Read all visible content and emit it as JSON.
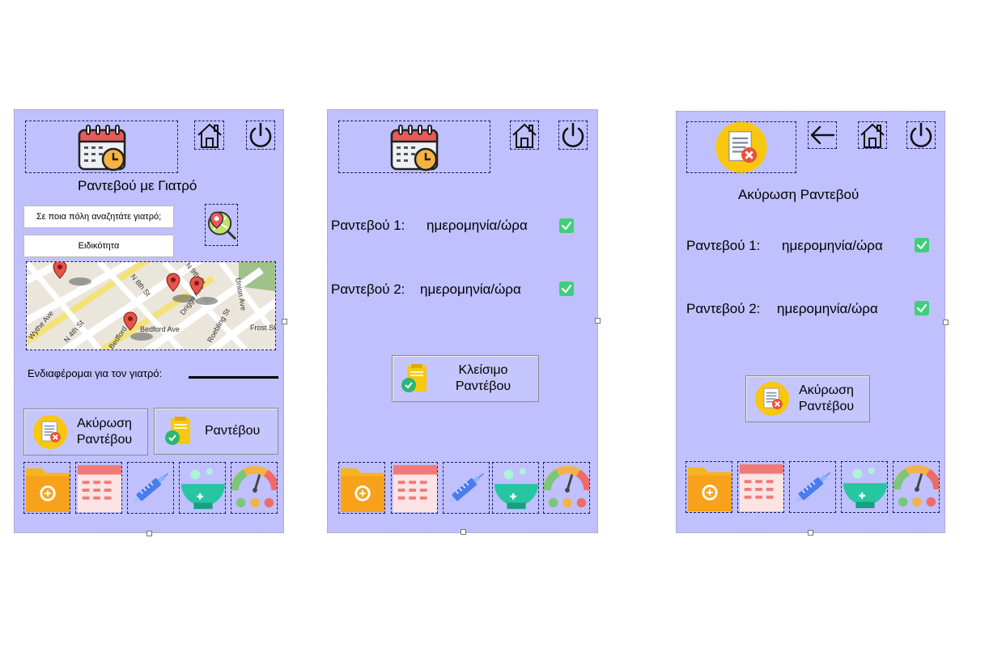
{
  "panel1": {
    "title": "Ραντεβού με Γιατρό",
    "city_placeholder": "Σε ποια πόλη αναζητάτε γιατρό;",
    "specialty_placeholder": "Ειδικότητα",
    "interest_label": "Ενδιαφέρομαι για τον γιατρό:",
    "map_labels": [
      "Wythe Ave",
      "N 4th St",
      "N 8th St",
      "N 9th St",
      "Driggs Ave",
      "Bedford Ave",
      "Union Ave",
      "Roebling St",
      "Frost St",
      "Bedford Ave"
    ],
    "cancel_button_label": "Ακύρωση Ραντέβου",
    "appointment_button_label": "Ραντέβου",
    "icons": [
      "calendar-icon",
      "home-icon",
      "power-icon",
      "map-search-icon"
    ]
  },
  "panel2": {
    "row1_label": "Ραντεβού 1:",
    "row1_value": "ημερομηνία/ώρα",
    "row2_label": "Ραντεβού 2:",
    "row2_value": "ημερομηνία/ώρα",
    "book_button_label": "Κλείσιμο Ραντέβου",
    "icons": [
      "calendar-icon",
      "home-icon",
      "power-icon"
    ]
  },
  "panel3": {
    "title": "Ακύρωση Ραντεβού",
    "row1_label": "Ραντεβού 1:",
    "row1_value": "ημερομηνία/ώρα",
    "row2_label": "Ραντεβού 2:",
    "row2_value": "ημερομηνία/ώρα",
    "cancel_button_label": "Ακύρωση Ραντέβου",
    "icons": [
      "cancel-document-icon",
      "back-arrow-icon",
      "home-icon",
      "power-icon"
    ]
  },
  "bottom_nav": [
    "medical-folder-icon",
    "calendar-grid-icon",
    "syringe-icon",
    "mortar-pestle-icon",
    "mood-gauge-icon"
  ],
  "colors": {
    "panel_bg": "#c0c0ff",
    "check_green": "#3ecf7a",
    "calendar_red": "#e85a5a",
    "orange": "#f5a623"
  }
}
